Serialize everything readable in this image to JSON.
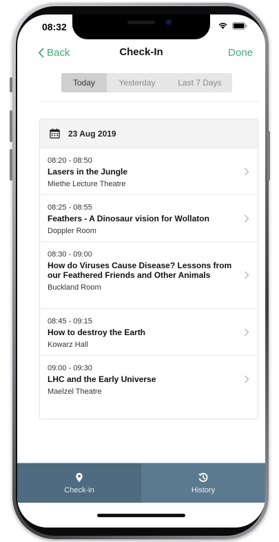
{
  "status_bar": {
    "time": "08:32",
    "extra_dots": "....",
    "icons": [
      "location-arrow-icon",
      "wifi-icon",
      "battery-icon"
    ]
  },
  "nav": {
    "back_label": "Back",
    "title": "Check-In",
    "done_label": "Done"
  },
  "segments": [
    {
      "label": "Today",
      "active": true
    },
    {
      "label": "Yesterday",
      "active": false
    },
    {
      "label": "Last 7 Days",
      "active": false
    }
  ],
  "card": {
    "date": "23 Aug 2019",
    "sessions": [
      {
        "time": "08:20 - 08:50",
        "title": "Lasers in the Jungle",
        "room": "Miethe Lecture Theatre"
      },
      {
        "time": "08:25 - 08:55",
        "title": "Feathers - A Dinosaur vision for Wollaton",
        "room": "Doppler Room"
      },
      {
        "time": "08:30 - 09:00",
        "title": "How do Viruses Cause Disease? Lessons from our Feathered Friends and Other Animals",
        "room": "Buckland Room"
      },
      {
        "time": "08:45 - 09:15",
        "title": "How to destroy the Earth",
        "room": "Kowarz Hall"
      },
      {
        "time": "09:00 - 09:30",
        "title": "LHC and the Early Universe",
        "room": "Maelzel Theatre"
      }
    ]
  },
  "tabbar": [
    {
      "label": "Check-in",
      "icon": "map-pin-icon",
      "active": true
    },
    {
      "label": "History",
      "icon": "history-icon",
      "active": false
    }
  ],
  "colors": {
    "accent": "#45a97a",
    "tab_active": "#4e6b80",
    "tab_inactive": "#5c7a8f"
  }
}
